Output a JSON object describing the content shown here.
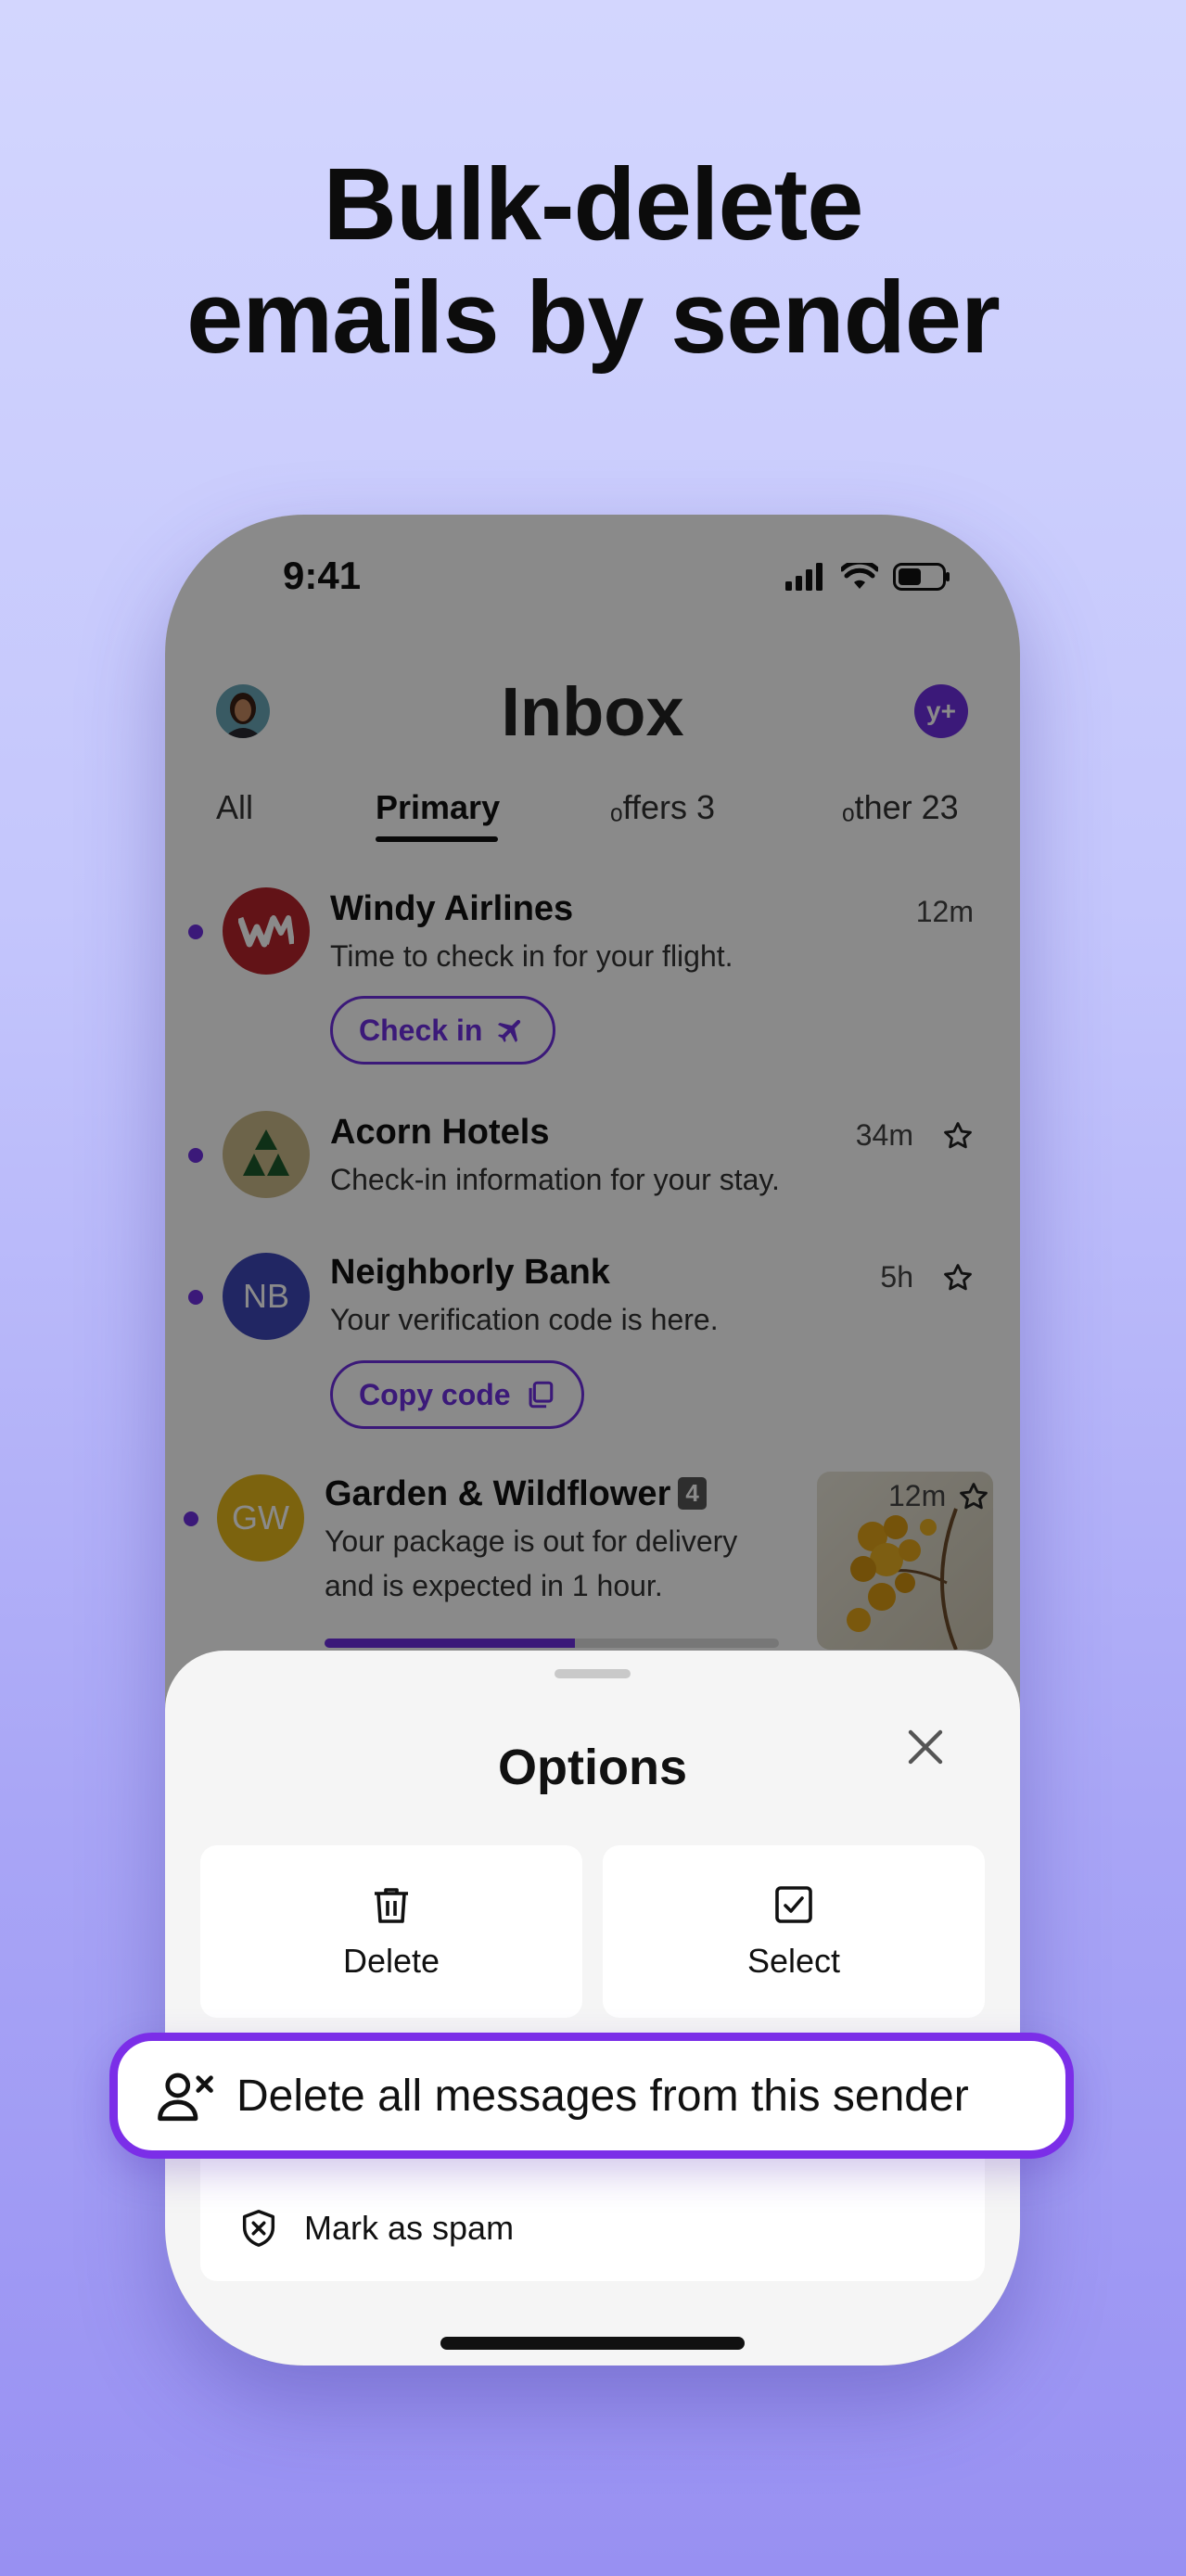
{
  "headline": {
    "line1": "Bulk-delete",
    "line2": "emails by sender"
  },
  "status_bar": {
    "time": "9:41",
    "icons": [
      "signal-icon",
      "wifi-icon",
      "battery-icon"
    ]
  },
  "inbox": {
    "title": "Inbox",
    "account_badge": "y+",
    "tabs": [
      {
        "label": "All"
      },
      {
        "label": "Primary",
        "active": true
      },
      {
        "label": "ₒffers 3"
      },
      {
        "label": "ₒther 23"
      }
    ],
    "emails": [
      {
        "sender": "Windy Airlines",
        "preview": "Time to check in for your flight.",
        "time": "12m",
        "action": "Check in",
        "avatar_color": "#b5232b",
        "unread": true
      },
      {
        "sender": "Acorn Hotels",
        "preview": "Check-in information for your stay.",
        "time": "34m",
        "avatar_color": "#c9b98a",
        "unread": true
      },
      {
        "sender": "Neighborly Bank",
        "preview": "Your verification code is here.",
        "time": "5h",
        "action": "Copy code",
        "avatar_text": "NB",
        "avatar_color": "#3d46b8",
        "unread": true
      },
      {
        "sender": "Garden & Wildflower",
        "thread_count": "4",
        "preview_line1": "Your package is out for delivery",
        "preview_line2": "and is expected in 1 hour.",
        "time": "12m",
        "avatar_text": "GW",
        "avatar_color": "#e6b81b",
        "unread": true,
        "delivery_progress": 0.55
      }
    ]
  },
  "options_sheet": {
    "title": "Options",
    "delete_label": "Delete",
    "select_label": "Select",
    "delete_sender_label": "Delete all messages from this sender",
    "spam_label": "Mark as spam"
  },
  "colors": {
    "accent": "#6d2fe0",
    "highlight_border": "#7b2ee8"
  }
}
